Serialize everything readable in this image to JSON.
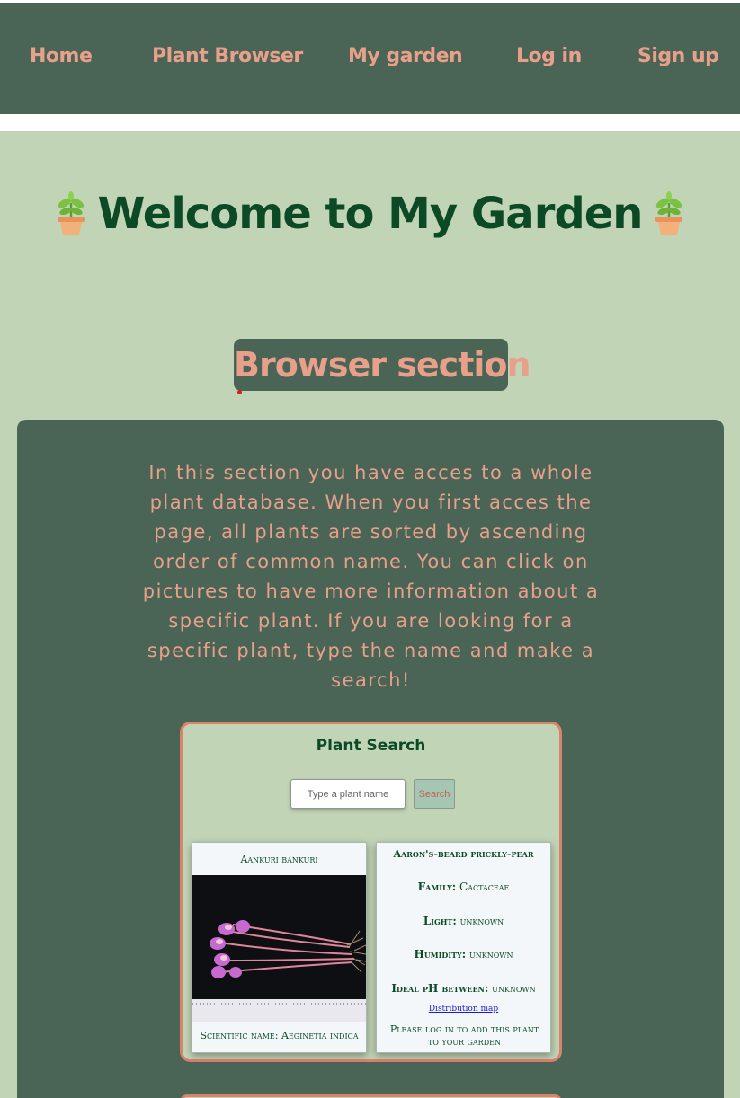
{
  "nav": {
    "items": [
      {
        "label": "Home"
      },
      {
        "label": "Plant Browser"
      },
      {
        "label": "My garden"
      },
      {
        "label": "Log in"
      },
      {
        "label": "Sign up"
      }
    ]
  },
  "hero": {
    "title": "Welcome to My Garden",
    "icon": "potted-plant-icon"
  },
  "section": {
    "badge": "Browser section",
    "description": "In this section you have acces to a whole plant database. When you first acces the page, all plants are sorted by ascending order of common name. You can click on pictures to have more information about a specific plant. If you are looking for a specific plant, type the name and make a search!"
  },
  "search": {
    "title": "Plant Search",
    "placeholder": "Type a plant name",
    "button": "Search"
  },
  "cards": {
    "front": {
      "common_name": "Aankuri bankuri",
      "scientific_name": "Scientific name: Aeginetia indica"
    },
    "back": {
      "common_name": "Aaron's-beard prickly-pear",
      "family_label": "Family:",
      "family_value": "Cactaceae",
      "light_label": "Light:",
      "light_value": "unknown",
      "humidity_label": "Humidity:",
      "humidity_value": "unknown",
      "ph_label": "Ideal pH between:",
      "ph_value": "unknown",
      "distribution_link": "Distribution map",
      "login_note": "Please log in to add this plant to your garden"
    }
  },
  "colors": {
    "nav_bg": "#4a6556",
    "page_bg": "#c2d4b6",
    "accent": "#e8a08a",
    "title": "#0b4a25",
    "card_border": "#d9826c"
  }
}
